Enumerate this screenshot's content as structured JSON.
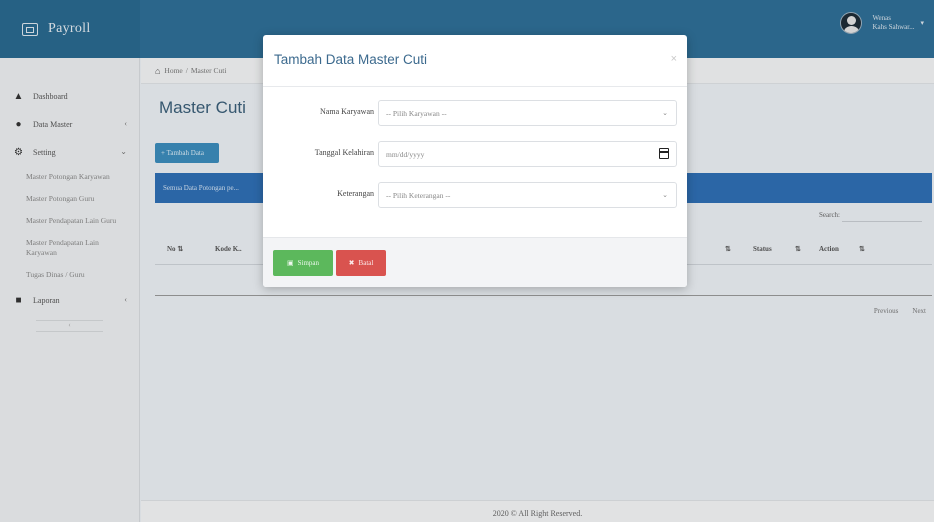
{
  "app": {
    "title": "Payroll"
  },
  "user": {
    "line1": "Wenas",
    "line2": "Kahs Sahwar..."
  },
  "sidebar": {
    "items": [
      {
        "label": "Dashboard",
        "icon": "dashboard-icon"
      },
      {
        "label": "Data Master",
        "icon": "user-icon"
      },
      {
        "label": "Setting",
        "icon": "cogs-icon"
      }
    ],
    "sub_items": [
      "Master Potongan Karyawan",
      "Master Potongan Guru",
      "Master Pendapatan Lain Guru",
      "Master Pendapatan Lain Karyawan",
      "Tugas Dinas / Guru"
    ],
    "report": {
      "label": "Laporan",
      "icon": "report-icon"
    }
  },
  "breadcrumb": {
    "home": "Home",
    "separator": "/",
    "current": "Master Cuti"
  },
  "page": {
    "title": "Master Cuti",
    "add_button": "+ Tambah Data",
    "panel_text": "Semua Data Potongan pe..."
  },
  "table": {
    "search_label": "Search:",
    "columns": [
      "No",
      "Kode K..",
      "Status",
      "Action"
    ],
    "pager": {
      "previous": "Previous",
      "next": "Next"
    }
  },
  "footer": {
    "text": "2020 © All Right Reserved."
  },
  "modal": {
    "title": "Tambah Data Master Cuti",
    "close": "×",
    "fields": [
      {
        "label": "Nama Karyawan",
        "value": "-- Pilih Karyawan --",
        "type": "select"
      },
      {
        "label": "Tanggal Kelahiran",
        "value": "mm/dd/yyyy",
        "type": "date"
      },
      {
        "label": "Keterangan",
        "value": "-- Pilih Keterangan --",
        "type": "select"
      }
    ],
    "save_button": "Simpan",
    "cancel_button": "Batal"
  },
  "colors": {
    "header": "#2f6f97",
    "primary": "#3c8dbc",
    "panel": "#2f6fb5",
    "success": "#5cb85c",
    "danger": "#d9534f"
  }
}
